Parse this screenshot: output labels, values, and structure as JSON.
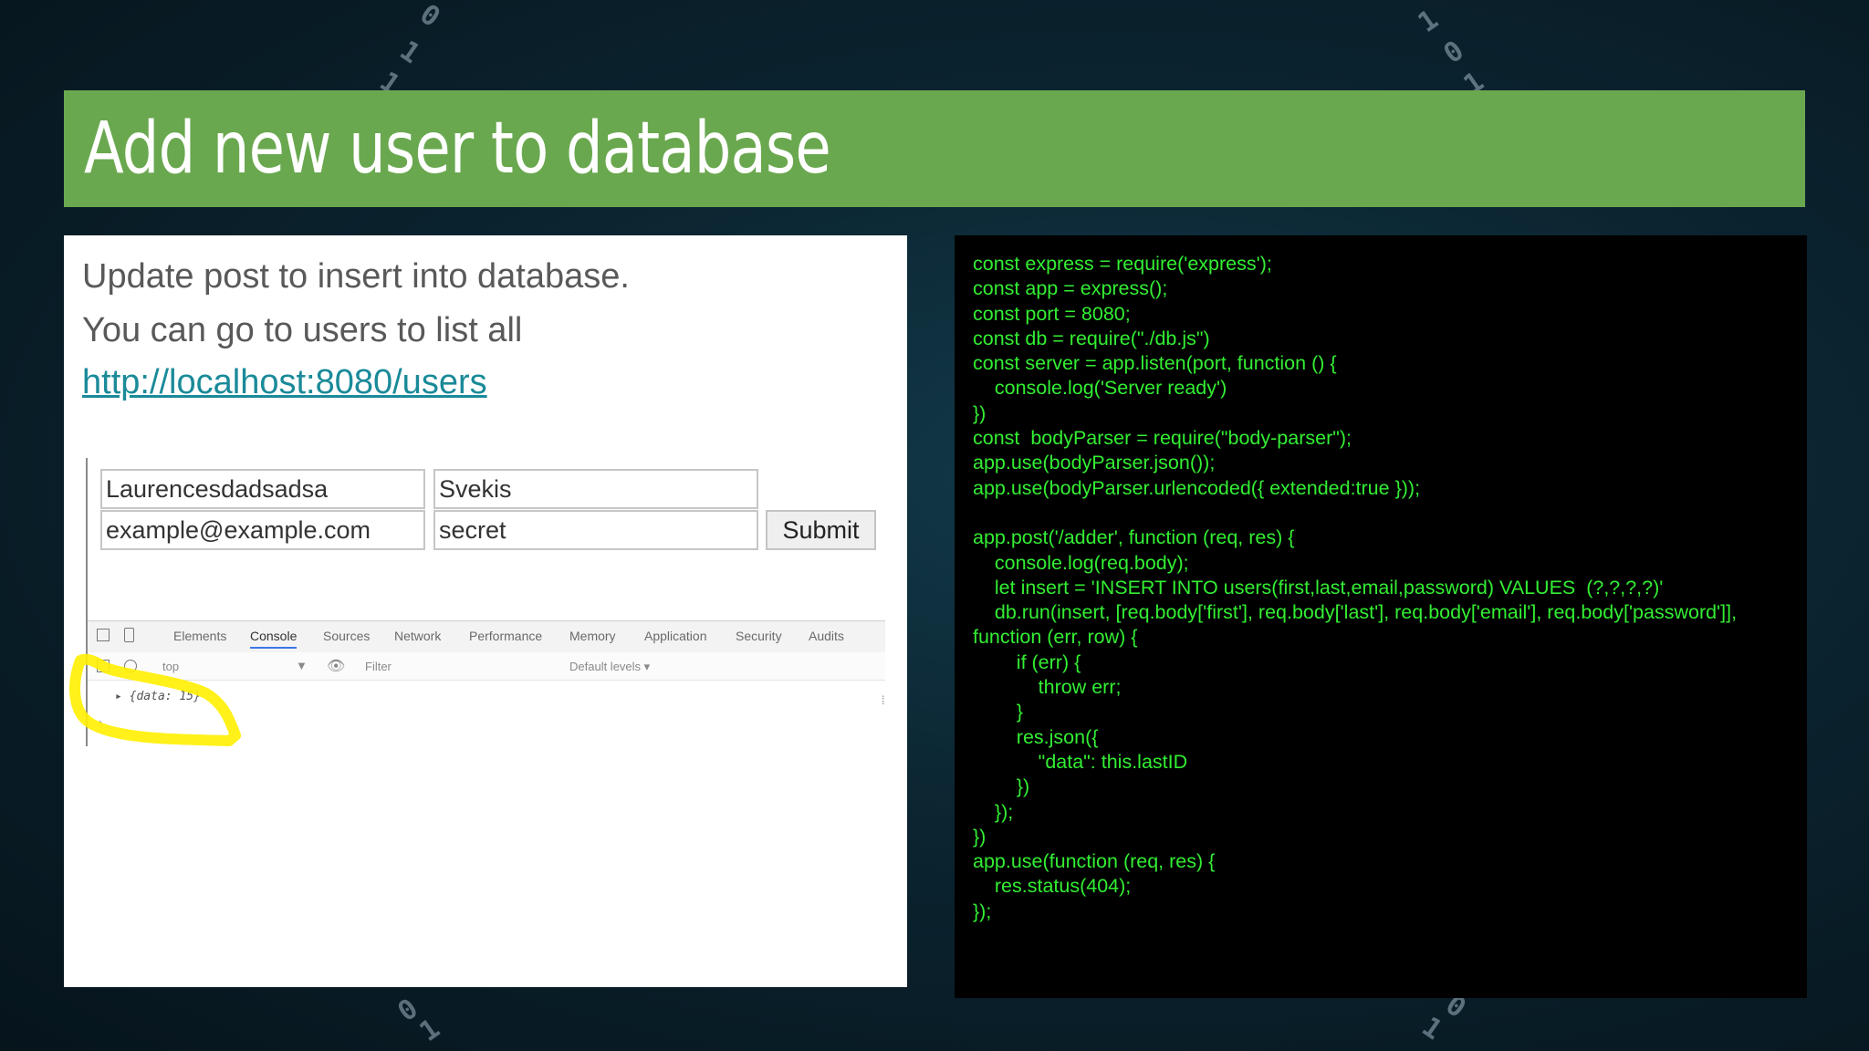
{
  "slide": {
    "title": "Add new user to database",
    "description_lines": [
      "Update post to insert into database.",
      "You can go to users to list all"
    ],
    "link_text": "http://localhost:8080/users"
  },
  "form": {
    "first_value": "Laurencesdadsadsa",
    "last_value": "Svekis",
    "email_value": "example@example.com",
    "password_value": "secret",
    "submit_label": "Submit"
  },
  "devtools": {
    "tabs": [
      "Elements",
      "Console",
      "Sources",
      "Network",
      "Performance",
      "Memory",
      "Application",
      "Security",
      "Audits"
    ],
    "active_tab": "Console",
    "context_value": "top",
    "filter_placeholder": "Filter",
    "levels_label": "Default levels ▾",
    "console_output": "▸ {data: 15}",
    "highlight_color": "#ffef00"
  },
  "code": {
    "lines": [
      "const express = require('express');",
      "const app = express();",
      "const port = 8080;",
      "const db = require(\"./db.js\")",
      "const server = app.listen(port, function () {",
      "    console.log('Server ready')",
      "})",
      "const  bodyParser = require(\"body-parser\");",
      "app.use(bodyParser.json());",
      "app.use(bodyParser.urlencoded({ extended:true }));",
      "",
      "app.post('/adder', function (req, res) {",
      "    console.log(req.body);",
      "    let insert = 'INSERT INTO users(first,last,email,password) VALUES  (?,?,?,?)'",
      "    db.run(insert, [req.body['first'], req.body['last'], req.body['email'], req.body['password']],",
      "function (err, row) {",
      "        if (err) {",
      "            throw err;",
      "        }",
      "        res.json({",
      "            \"data\": this.lastID",
      "        })",
      "    });",
      "})",
      "app.use(function (req, res) {",
      "    res.status(404);",
      "});"
    ]
  },
  "colors": {
    "title_bar": "#6aa84f",
    "code_text": "#33ee33",
    "link": "#1a8a99"
  }
}
